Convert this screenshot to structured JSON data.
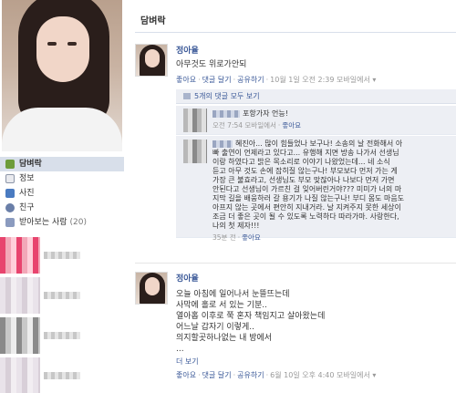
{
  "wall": {
    "title": "담벼락"
  },
  "nav": [
    {
      "label": "담벼락",
      "icon": "wall-icon",
      "active": true
    },
    {
      "label": "정보",
      "icon": "info-icon"
    },
    {
      "label": "사진",
      "icon": "photo-icon"
    },
    {
      "label": "친구",
      "icon": "friends-icon"
    },
    {
      "label": "받아보는 사람",
      "count": "(20)",
      "icon": "subscribers-icon"
    }
  ],
  "post1": {
    "author": "정아율",
    "message": "아무것도 위로가안되",
    "actions": {
      "like": "좋아요",
      "comment": "댓글 달기",
      "share": "공유하기",
      "time": "10월 1일 오전 2:39",
      "via": "모바일에서",
      "dot": "·"
    },
    "view_all": "5개의 댓글 모두 보기",
    "comment1": {
      "text": "포항가자 언능!",
      "time": "오전 7:54 모바일에서",
      "like": "좋아요"
    },
    "comment2": {
      "lines": [
        "혜진아... 많이 힘들었나 보구나! 소송의 날 전화해서 아",
        "빠 출연이 언제라고 있다고... 유행해 지면 방송 나가서 선생님",
        "이랑 하였다고 밝은 목소리로 이야기 나왔었는데... 네 소식",
        "듣고 아무 것도 손에 잡히질 않는구나! 부모보다 먼저 가는 게",
        "가장 큰 불효라고, 선생님도 부모 맞잖아나 나보다 먼저 가면",
        "안된다고 선생님이 가르친 걸 잊어버린거야??? 미미가 너의 마",
        "지막 길을 배웅하러 갈 용기가 나질 않는구나! 부디 몸도 마음도",
        "아프지 않는 곳에서 편안히 지내거라. 날 지켜주지 못한 세상이",
        "조금 더 좋은 곳이 될 수 있도록 노력하다 따라가마. 사랑한다,",
        "나의 첫 제자!!!"
      ],
      "time": "35분 전",
      "like": "좋아요"
    }
  },
  "post2": {
    "author": "정아율",
    "message_lines": [
      "오늘 아침에 일어나서 눈뜰뜨는데",
      "사막에 홀로 서 있는 기분..",
      "열아홉 이후로 쭉 혼자 책임지고 살아왔는데",
      "어느날 갑자기 이렇게..",
      "의지할곳하나없는 내 방에서",
      "..."
    ],
    "more": "더 보기",
    "actions": {
      "like": "좋아요",
      "comment": "댓글 달기",
      "share": "공유하기",
      "time": "6월 10일 오후 4:40",
      "via": "모바일에서",
      "dot": "·"
    }
  }
}
